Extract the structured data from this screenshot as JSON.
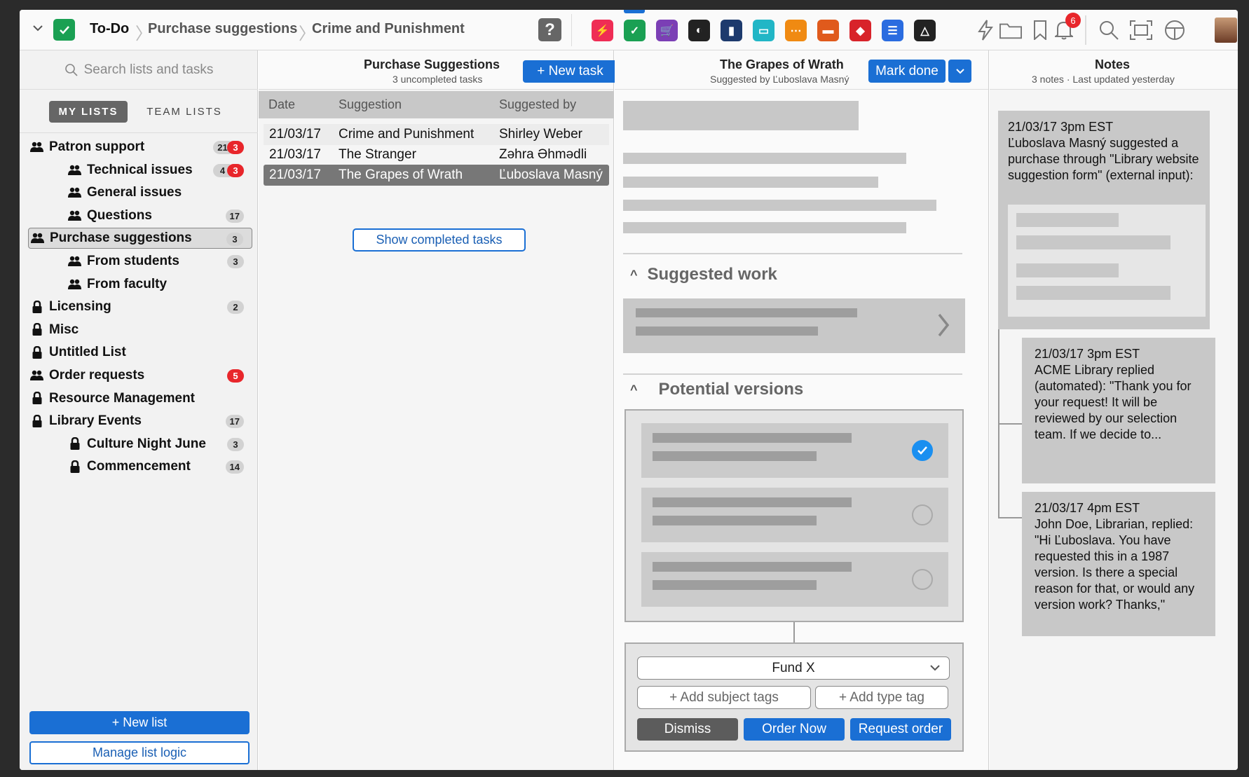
{
  "topbar": {
    "breadcrumb": [
      "To-Do",
      "Purchase suggestions",
      "Crime and Punishment"
    ],
    "help_label": "?",
    "notification_count": "6",
    "apps": [
      {
        "name": "bolt-app-icon",
        "color": "#ef2d55",
        "glyph": "⚡"
      },
      {
        "name": "todo-app-icon",
        "color": "#1aa053",
        "glyph": "✓"
      },
      {
        "name": "cart-app-icon",
        "color": "#7b3fb5",
        "glyph": "🛒"
      },
      {
        "name": "moon-app-icon",
        "color": "#222222",
        "glyph": "◐"
      },
      {
        "name": "door-app-icon",
        "color": "#1d3a6d",
        "glyph": "▮"
      },
      {
        "name": "chat-app-icon",
        "color": "#21b6c6",
        "glyph": "▭"
      },
      {
        "name": "share-app-icon",
        "color": "#f08a12",
        "glyph": "⋯"
      },
      {
        "name": "archive-app-icon",
        "color": "#e05a1c",
        "glyph": "▬"
      },
      {
        "name": "dice-app-icon",
        "color": "#d8232a",
        "glyph": "◆"
      },
      {
        "name": "database-app-icon",
        "color": "#2a6ce0",
        "glyph": "☰"
      },
      {
        "name": "drive-app-icon",
        "color": "#222222",
        "glyph": "△"
      }
    ]
  },
  "sidebar": {
    "search_placeholder": "Search lists and tasks",
    "tab_my": "MY LISTS",
    "tab_team": "TEAM LISTS",
    "items": [
      {
        "label": "Patron support",
        "icon": "team",
        "indent": 0,
        "badge": "21",
        "red_badge": "3"
      },
      {
        "label": "Technical issues",
        "icon": "team",
        "indent": 1,
        "badge": "4",
        "red_badge": "3"
      },
      {
        "label": "General issues",
        "icon": "team",
        "indent": 1,
        "badge": "",
        "red_badge": ""
      },
      {
        "label": "Questions",
        "icon": "team",
        "indent": 1,
        "badge": "17",
        "red_badge": ""
      },
      {
        "label": "Purchase suggestions",
        "icon": "team",
        "indent": 0,
        "badge": "3",
        "red_badge": "",
        "selected": true
      },
      {
        "label": "From students",
        "icon": "team",
        "indent": 1,
        "badge": "3",
        "red_badge": ""
      },
      {
        "label": "From faculty",
        "icon": "team",
        "indent": 1,
        "badge": "",
        "red_badge": ""
      },
      {
        "label": "Licensing",
        "icon": "lock",
        "indent": 0,
        "badge": "2",
        "red_badge": ""
      },
      {
        "label": "Misc",
        "icon": "lock",
        "indent": 0,
        "badge": "",
        "red_badge": ""
      },
      {
        "label": "Untitled List",
        "icon": "lock",
        "indent": 0,
        "badge": "",
        "red_badge": ""
      },
      {
        "label": "Order requests",
        "icon": "team",
        "indent": 0,
        "badge": "",
        "red_badge": "5"
      },
      {
        "label": "Resource Management",
        "icon": "lock",
        "indent": 0,
        "badge": "",
        "red_badge": ""
      },
      {
        "label": "Library Events",
        "icon": "lock",
        "indent": 0,
        "badge": "17",
        "red_badge": ""
      },
      {
        "label": "Culture Night June",
        "icon": "lock",
        "indent": 1,
        "badge": "3",
        "red_badge": ""
      },
      {
        "label": "Commencement",
        "icon": "lock",
        "indent": 1,
        "badge": "14",
        "red_badge": ""
      }
    ],
    "new_list_label": "+ New list",
    "manage_logic_label": "Manage list logic"
  },
  "tasks": {
    "title": "Purchase Suggestions",
    "subtitle": "3 uncompleted tasks",
    "new_task_label": "+ New task",
    "columns": [
      "Date",
      "Suggestion",
      "Suggested by"
    ],
    "rows": [
      {
        "date": "21/03/17",
        "suggestion": "Crime and Punishment",
        "by": "Shirley Weber"
      },
      {
        "date": "21/03/17",
        "suggestion": "The Stranger",
        "by": "Zəhra Əhmədli"
      },
      {
        "date": "21/03/17",
        "suggestion": "The Grapes of Wrath",
        "by": "Ľuboslava Masný"
      }
    ],
    "show_completed_label": "Show completed tasks"
  },
  "detail": {
    "title": "The Grapes of Wrath",
    "subtitle": "Suggested by Ľuboslava Masný",
    "mark_done_label": "Mark done",
    "suggested_work_heading": "Suggested work",
    "potential_versions_heading": "Potential versions",
    "fund_value": "Fund X",
    "add_subject_tags_label": "+ Add subject tags",
    "add_type_tag_label": "+ Add type tag",
    "dismiss_label": "Dismiss",
    "order_now_label": "Order Now",
    "request_order_label": "Request order"
  },
  "notes": {
    "title": "Notes",
    "subtitle": "3 notes · Last updated yesterday",
    "items": [
      {
        "time": "21/03/17 3pm EST",
        "text": "Ľuboslava Masný suggested a purchase through \"Library website suggestion form\" (external input):"
      },
      {
        "time": "21/03/17 3pm EST",
        "text": "ACME Library replied (automated): \"Thank you for your request! It will be reviewed by our selection team. If we decide to..."
      },
      {
        "time": "21/03/17 4pm EST",
        "text": "John Doe, Librarian, replied: \"Hi Ľuboslava. You have requested this in a 1987 version. Is there a special reason for that, or would any version work? Thanks,\""
      }
    ]
  },
  "colors": {
    "accent": "#1a6fd4",
    "alert": "#e8262b",
    "done": "#1aa053"
  }
}
